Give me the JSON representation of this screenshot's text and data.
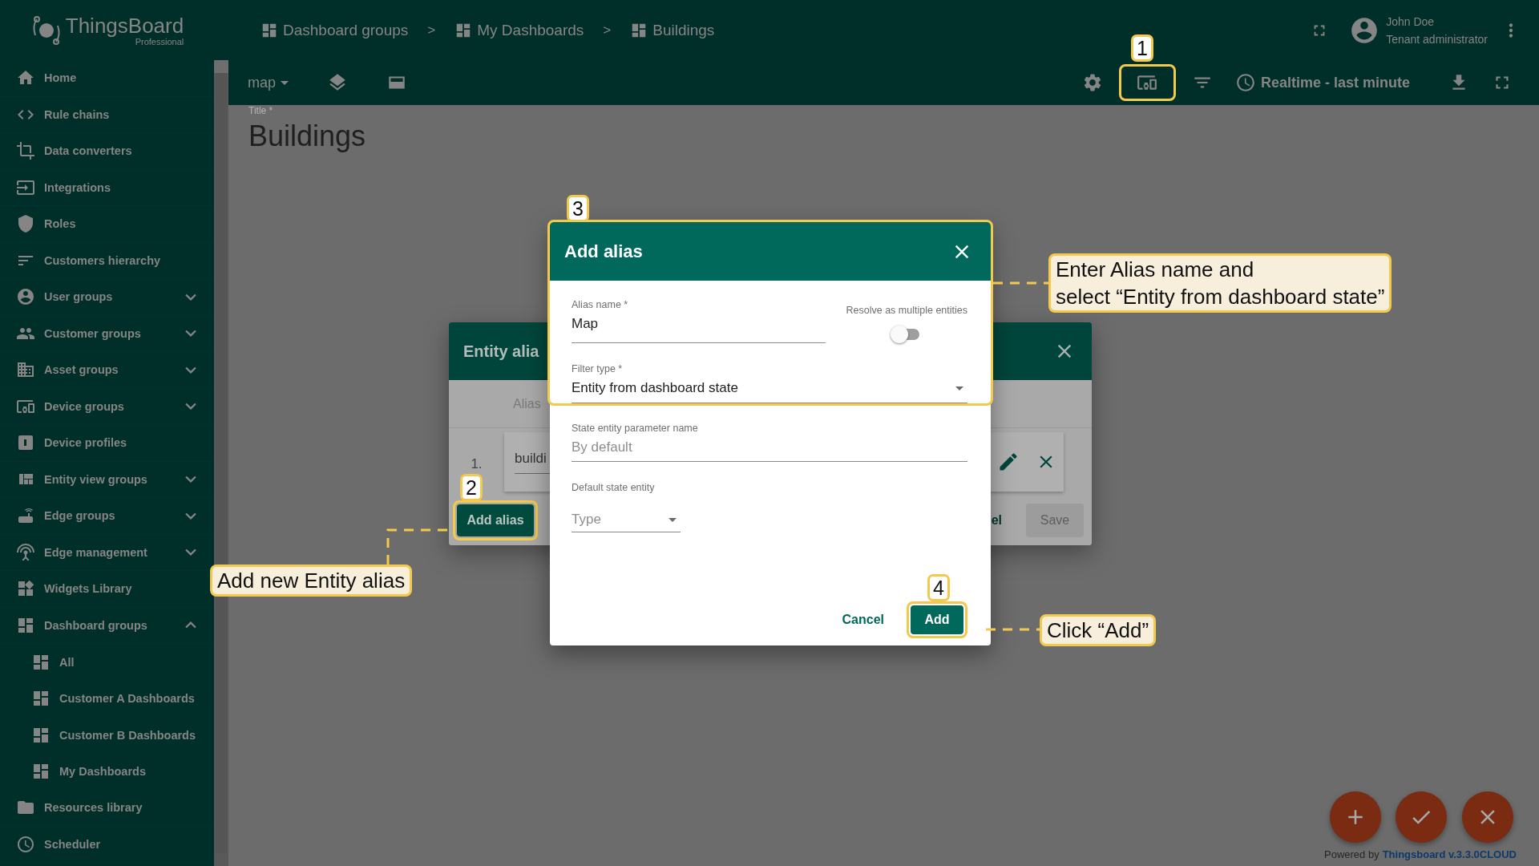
{
  "logo": {
    "name": "ThingsBoard",
    "edition": "Professional"
  },
  "sidebar": {
    "items": [
      {
        "label": "Home"
      },
      {
        "label": "Rule chains"
      },
      {
        "label": "Data converters"
      },
      {
        "label": "Integrations"
      },
      {
        "label": "Roles"
      },
      {
        "label": "Customers hierarchy"
      },
      {
        "label": "User groups",
        "expanded": false
      },
      {
        "label": "Customer groups",
        "expanded": false
      },
      {
        "label": "Asset groups",
        "expanded": false
      },
      {
        "label": "Device groups",
        "expanded": false
      },
      {
        "label": "Device profiles"
      },
      {
        "label": "Entity view groups",
        "expanded": false
      },
      {
        "label": "Edge groups",
        "expanded": false
      },
      {
        "label": "Edge management",
        "expanded": false
      },
      {
        "label": "Widgets Library"
      },
      {
        "label": "Dashboard groups",
        "expanded": true,
        "children": [
          {
            "label": "All"
          },
          {
            "label": "Customer A Dashboards"
          },
          {
            "label": "Customer B Dashboards"
          },
          {
            "label": "My Dashboards"
          }
        ]
      },
      {
        "label": "Resources library"
      },
      {
        "label": "Scheduler"
      }
    ]
  },
  "breadcrumbs": [
    {
      "label": "Dashboard groups"
    },
    {
      "label": "My Dashboards"
    },
    {
      "label": "Buildings"
    }
  ],
  "breadcrumb_separators": [
    ">",
    ">"
  ],
  "user": {
    "name": "John Doe",
    "role": "Tenant administrator"
  },
  "toolbar": {
    "state_select": "map",
    "timewindow": "Realtime - last minute"
  },
  "title_label": "Title *",
  "title": "Buildings",
  "entity_aliases_dialog": {
    "title": "Entity alia",
    "column_header": "Alias",
    "row_index": "1.",
    "row_value": "buildi",
    "cancel": "el",
    "save": "Save",
    "save_disabled": true,
    "add_button": "Add alias"
  },
  "add_alias_dialog": {
    "title": "Add alias",
    "alias_name_label": "Alias name *",
    "alias_name": "Map",
    "resolve_label": "Resolve as multiple entities",
    "resolve_multiple": false,
    "filter_type_label": "Filter type *",
    "filter_type": "Entity from dashboard state",
    "state_param_label": "State entity parameter name",
    "state_param_placeholder": "By default",
    "default_state_label": "Default state entity",
    "type_placeholder": "Type",
    "cancel": "Cancel",
    "add": "Add"
  },
  "steps": [
    {
      "number": "1"
    },
    {
      "number": "2",
      "lines": [
        "Add new Entity alias"
      ]
    },
    {
      "number": "3",
      "lines": [
        "Enter Alias name and",
        "select “Entity from dashboard state”"
      ]
    },
    {
      "number": "4",
      "lines": [
        "Click “Add”"
      ]
    }
  ],
  "footer": {
    "prefix": "Powered by",
    "link": "Thingsboard v.3.3.0CLOUD"
  }
}
